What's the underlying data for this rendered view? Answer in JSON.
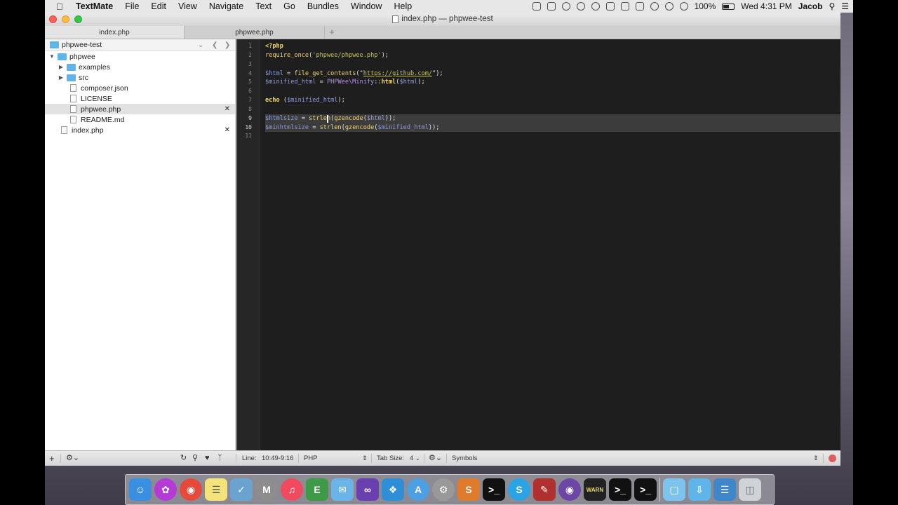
{
  "menubar": {
    "app_name": "TextMate",
    "items": [
      "File",
      "Edit",
      "View",
      "Navigate",
      "Text",
      "Go",
      "Bundles",
      "Window",
      "Help"
    ],
    "battery": "100%",
    "clock": "Wed 4:31 PM",
    "user": "Jacob"
  },
  "window": {
    "title": "index.php — phpwee-test"
  },
  "tabs": [
    {
      "label": "index.php"
    },
    {
      "label": "phpwee.php"
    }
  ],
  "sidebar": {
    "project": "phpwee-test",
    "tree": [
      {
        "label": "phpwee"
      },
      {
        "label": "examples"
      },
      {
        "label": "src"
      },
      {
        "label": "composer.json"
      },
      {
        "label": "LICENSE"
      },
      {
        "label": "phpwee.php"
      },
      {
        "label": "README.md"
      },
      {
        "label": "index.php"
      }
    ]
  },
  "editor": {
    "line_numbers": [
      "1",
      "2",
      "3",
      "4",
      "5",
      "6",
      "7",
      "8",
      "9",
      "10",
      "11"
    ],
    "code": {
      "l1": "<?php",
      "l2_fn": "require_once",
      "l2_a": "(",
      "l2_str": "'phpwee/phpwee.php'",
      "l2_b": ");",
      "l4_var": "$html",
      "l4_a": " = ",
      "l4_fn": "file_get_contents",
      "l4_b": "(\"",
      "l4_url": "https://github.com/",
      "l4_c": "\");",
      "l5_var": "$minified_html",
      "l5_a": " = ",
      "l5_cls": "PHPWee\\Minify",
      "l5_b": "::",
      "l5_fn": "html",
      "l5_c": "(",
      "l5_var2": "$html",
      "l5_d": ");",
      "l7_kw": "echo",
      "l7_a": " (",
      "l7_var": "$minified_html",
      "l7_b": ");",
      "l9_var": "$htmlsize",
      "l9_a": " = ",
      "l9_fn": "strlen",
      "l9_b": "(",
      "l9_fn2": "gzencode",
      "l9_c": "(",
      "l9_var2": "$html",
      "l9_d": "));",
      "l10_var": "$minhtmlsize",
      "l10_a": " = ",
      "l10_fn": "strlen",
      "l10_b": "(",
      "l10_fn2": "gzencode",
      "l10_c": "(",
      "l10_var2": "$minified_html",
      "l10_d": "));"
    }
  },
  "statusbar": {
    "line_label": "Line:",
    "line_value": "10:49-9:16",
    "language": "PHP",
    "tab_size_label": "Tab Size:",
    "tab_size_value": "4",
    "symbols": "Symbols"
  },
  "dock": {
    "apps": [
      "Finder",
      "Flower",
      "Chrome",
      "Notes",
      "Preview",
      "Mail",
      "iTunes",
      "Evernote",
      "Messages",
      "Visual Studio",
      "Windows",
      "App Store",
      "Settings",
      "Sublime Text",
      "Terminal",
      "Skype",
      "Pen",
      "GitHub",
      "Console",
      "Terminal 2",
      "Terminal 3",
      "Documents",
      "Downloads",
      "Applications",
      "Trash"
    ]
  },
  "colors": {
    "editor_bg": "#1e1e1e",
    "keyword": "#f5d66b",
    "variable": "#8c9de0",
    "string": "#c7c45f",
    "class": "#b58de8"
  }
}
